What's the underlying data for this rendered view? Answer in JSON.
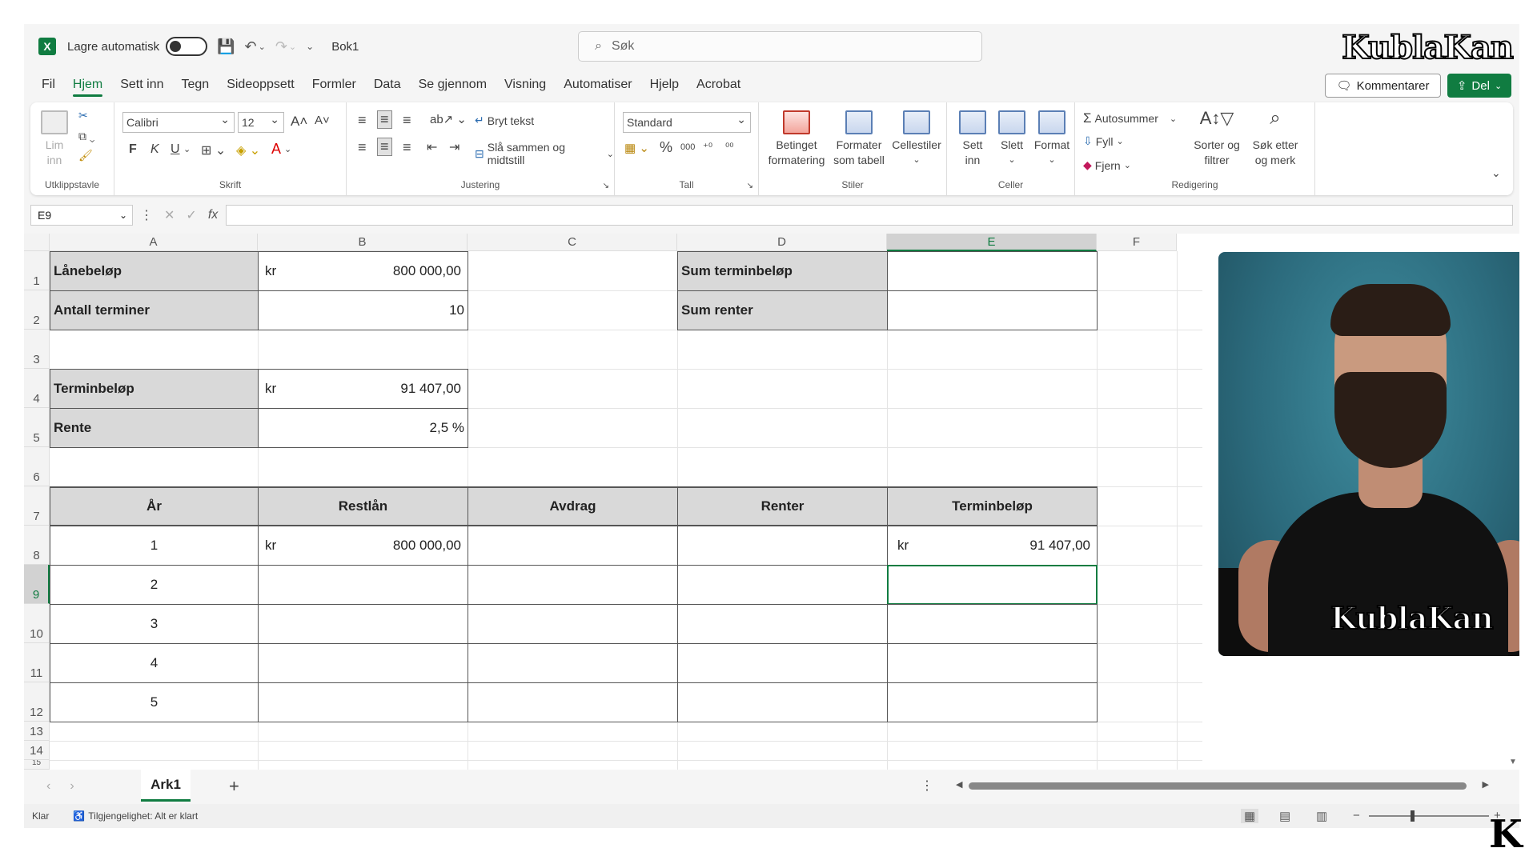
{
  "titlebar": {
    "autosave_label": "Lagre automatisk",
    "filename": "Bok1",
    "search_placeholder": "Søk",
    "brand": "KublaKan"
  },
  "menu": [
    "Fil",
    "Hjem",
    "Sett inn",
    "Tegn",
    "Sideoppsett",
    "Formler",
    "Data",
    "Se gjennom",
    "Visning",
    "Automatiser",
    "Hjelp",
    "Acrobat"
  ],
  "actions": {
    "comment": "Kommentarer",
    "share": "Del"
  },
  "ribbon": {
    "clipboard": {
      "paste": "Lim inn",
      "label": "Utklippstavle"
    },
    "font": {
      "name": "Calibri",
      "size": "12",
      "bold": "F",
      "italic": "K",
      "underline": "U",
      "label": "Skrift"
    },
    "alignment": {
      "wrap": "Bryt tekst",
      "merge": "Slå sammen og midtstill",
      "label": "Justering"
    },
    "number": {
      "format": "Standard",
      "percent": "%",
      "thousands": "000",
      "label": "Tall"
    },
    "styles": {
      "conditional_1": "Betinget",
      "conditional_2": "formatering",
      "table_1": "Formater",
      "table_2": "som tabell",
      "cell_styles": "Cellestiler",
      "label": "Stiler"
    },
    "cells": {
      "insert_1": "Sett",
      "insert_2": "inn",
      "delete": "Slett",
      "format": "Format",
      "label": "Celler"
    },
    "editing": {
      "autosum": "Autosummer",
      "fill": "Fyll",
      "clear": "Fjern",
      "sort_1": "Sorter og",
      "sort_2": "filtrer",
      "find_1": "Søk etter",
      "find_2": "og merk",
      "label": "Redigering"
    }
  },
  "formula_bar": {
    "name_box": "E9",
    "fx": "fx",
    "value": ""
  },
  "columns": [
    "A",
    "B",
    "C",
    "D",
    "E",
    "F"
  ],
  "rows": [
    "1",
    "2",
    "3",
    "4",
    "5",
    "6",
    "7",
    "8",
    "9",
    "10",
    "11",
    "12",
    "13",
    "14",
    "15"
  ],
  "params": {
    "loan_label": "Lånebeløp",
    "loan_currency": "kr",
    "loan_value": "800 000,00",
    "terms_label": "Antall terminer",
    "terms_value": "10",
    "payment_label": "Terminbeløp",
    "payment_currency": "kr",
    "payment_value": "91 407,00",
    "rate_label": "Rente",
    "rate_value": "2,5 %",
    "sum_payment_label": "Sum terminbeløp",
    "sum_interest_label": "Sum renter"
  },
  "table": {
    "headers": [
      "År",
      "Restlån",
      "Avdrag",
      "Renter",
      "Terminbeløp"
    ],
    "rows": [
      {
        "year": "1",
        "loan_currency": "kr",
        "loan": "800 000,00",
        "pay_currency": "kr",
        "pay": "91 407,00"
      },
      {
        "year": "2"
      },
      {
        "year": "3"
      },
      {
        "year": "4"
      },
      {
        "year": "5"
      }
    ]
  },
  "video_overlay": {
    "brand": "KublaKan"
  },
  "sheets": {
    "active": "Ark1",
    "add": "+"
  },
  "status": {
    "ready": "Klar",
    "accessibility": "Tilgjengelighet: Alt er klart",
    "zoom_minus": "−",
    "zoom_plus": "+"
  },
  "corner_logo": "K",
  "colors": {
    "accent": "#107c41",
    "header_fill": "#d9d9d9"
  }
}
